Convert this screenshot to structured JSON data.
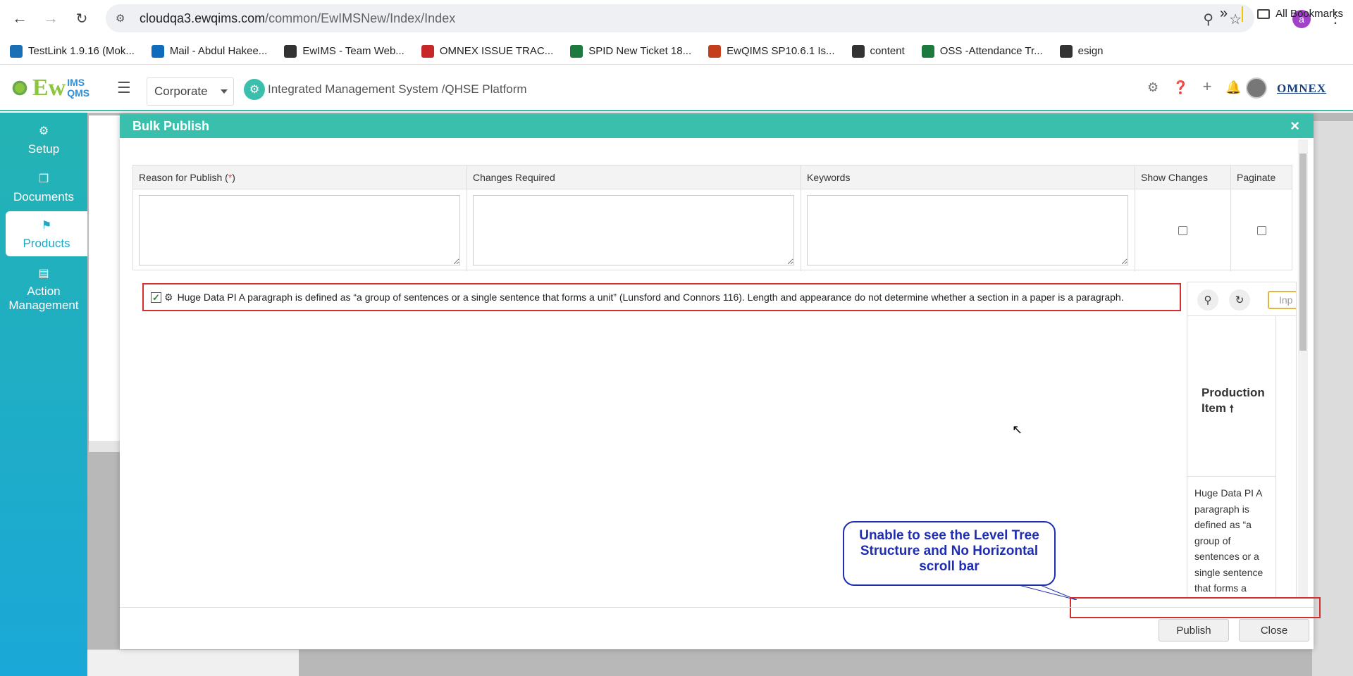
{
  "browser": {
    "url_host": "cloudqa3.ewqims.com",
    "url_path": "/common/EwIMSNew/Index/Index",
    "profile_initial": "a",
    "bookmarks": [
      {
        "label": "TestLink 1.9.16 (Mok...",
        "color": "#1a6fb5"
      },
      {
        "label": "Mail - Abdul Hakee...",
        "color": "#0f6cbd"
      },
      {
        "label": "EwIMS - Team Web...",
        "color": "#333333"
      },
      {
        "label": "OMNEX ISSUE TRAC...",
        "color": "#c62828"
      },
      {
        "label": "SPID New Ticket 18...",
        "color": "#1d7a3e"
      },
      {
        "label": "EwQIMS SP10.6.1 Is...",
        "color": "#c43e1c"
      },
      {
        "label": "content",
        "color": "#333333"
      },
      {
        "label": "OSS -Attendance Tr...",
        "color": "#1d7a3e"
      },
      {
        "label": "esign",
        "color": "#333333"
      }
    ],
    "all_bookmarks_label": "All Bookmarks",
    "overflow_label": "»"
  },
  "app": {
    "logo_ew": "Ew",
    "logo_ims": "IMS",
    "logo_qms": "QMS",
    "corp_select": "Corporate",
    "platform_title": "Integrated Management System /QHSE Platform",
    "brand": "OMNEX",
    "accent": "#3bbfad"
  },
  "sidebar": {
    "items": [
      {
        "label": "Setup",
        "icon": "gears-icon"
      },
      {
        "label": "Documents",
        "icon": "copy-icon"
      },
      {
        "label": "Products",
        "icon": "flag-icon"
      },
      {
        "label_line1": "Action",
        "label_line2": "Management",
        "icon": "doc-icon"
      }
    ]
  },
  "modal": {
    "title": "Bulk Publish",
    "close_glyph": "×",
    "columns": {
      "reason": "Reason for Publish (",
      "reason_req": "*",
      "reason_end": ")",
      "changes": "Changes Required",
      "keywords": "Keywords",
      "show_changes": "Show Changes",
      "paginate": "Paginate"
    },
    "tree_item": "Huge Data PI A paragraph is defined as “a group of sentences or a single sentence that forms a unit” (Lunsford and Connors 116). Length and appearance do not determine whether a section in a paper is a paragraph.",
    "grid": {
      "input_placeholder": "Inp",
      "header_line1": "Production",
      "header_line2": "Item",
      "sort_glyph": "🠕",
      "cell_text": "Huge Data PI A paragraph is defined as “a group of sentences or a single sentence that forms a"
    },
    "callout": "Unable to see the Level Tree Structure and No Horizontal scroll bar",
    "publish_label": "Publish",
    "close_label": "Close"
  }
}
